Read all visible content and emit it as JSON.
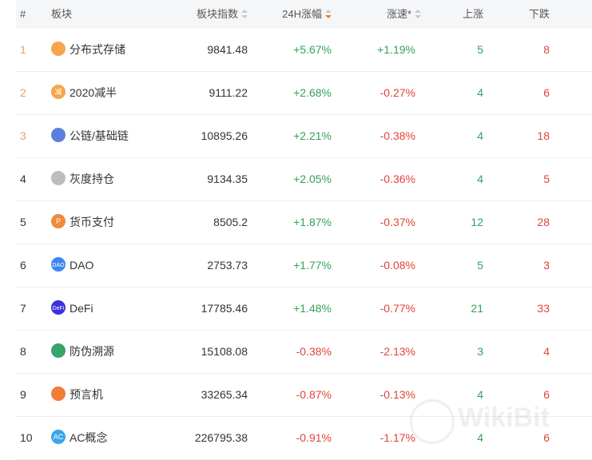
{
  "header": {
    "rank": "#",
    "name": "板块",
    "index": "板块指数",
    "change": "24H涨幅",
    "speed": "涨速*",
    "up": "上涨",
    "down": "下跌"
  },
  "rows": [
    {
      "rank": "1",
      "name": "分布式存储",
      "index": "9841.48",
      "change": "+5.67%",
      "speed": "+1.19%",
      "up": "5",
      "down": "8",
      "icon": "storage-icon",
      "icon_text": ""
    },
    {
      "rank": "2",
      "name": "2020减半",
      "index": "9111.22",
      "change": "+2.68%",
      "speed": "-0.27%",
      "up": "4",
      "down": "6",
      "icon": "halving-icon",
      "icon_text": "减"
    },
    {
      "rank": "3",
      "name": "公链/基础链",
      "index": "10895.26",
      "change": "+2.21%",
      "speed": "-0.38%",
      "up": "4",
      "down": "18",
      "icon": "chain-icon",
      "icon_text": ""
    },
    {
      "rank": "4",
      "name": "灰度持仓",
      "index": "9134.35",
      "change": "+2.05%",
      "speed": "-0.36%",
      "up": "4",
      "down": "5",
      "icon": "grayscale-icon",
      "icon_text": ""
    },
    {
      "rank": "5",
      "name": "货币支付",
      "index": "8505.2",
      "change": "+1.87%",
      "speed": "-0.37%",
      "up": "12",
      "down": "28",
      "icon": "payment-icon",
      "icon_text": "P"
    },
    {
      "rank": "6",
      "name": "DAO",
      "index": "2753.73",
      "change": "+1.77%",
      "speed": "-0.08%",
      "up": "5",
      "down": "3",
      "icon": "dao-icon",
      "icon_text": "DAO"
    },
    {
      "rank": "7",
      "name": "DeFi",
      "index": "17785.46",
      "change": "+1.48%",
      "speed": "-0.77%",
      "up": "21",
      "down": "33",
      "icon": "defi-icon",
      "icon_text": "DeFi"
    },
    {
      "rank": "8",
      "name": "防伪溯源",
      "index": "15108.08",
      "change": "-0.38%",
      "speed": "-2.13%",
      "up": "3",
      "down": "4",
      "icon": "traceability-icon",
      "icon_text": ""
    },
    {
      "rank": "9",
      "name": "预言机",
      "index": "33265.34",
      "change": "-0.87%",
      "speed": "-0.13%",
      "up": "4",
      "down": "6",
      "icon": "oracle-icon",
      "icon_text": ""
    },
    {
      "rank": "10",
      "name": "AC概念",
      "index": "226795.38",
      "change": "-0.91%",
      "speed": "-1.17%",
      "up": "4",
      "down": "6",
      "icon": "ac-icon",
      "icon_text": "AC"
    }
  ],
  "watermark": {
    "text": "WikiBit"
  },
  "colors": {
    "positive": "#35a25a",
    "negative": "#e0443a",
    "rank_top": "#e8a06a",
    "sort_active": "#f07c2b",
    "header_bg": "#f5f6f8"
  }
}
